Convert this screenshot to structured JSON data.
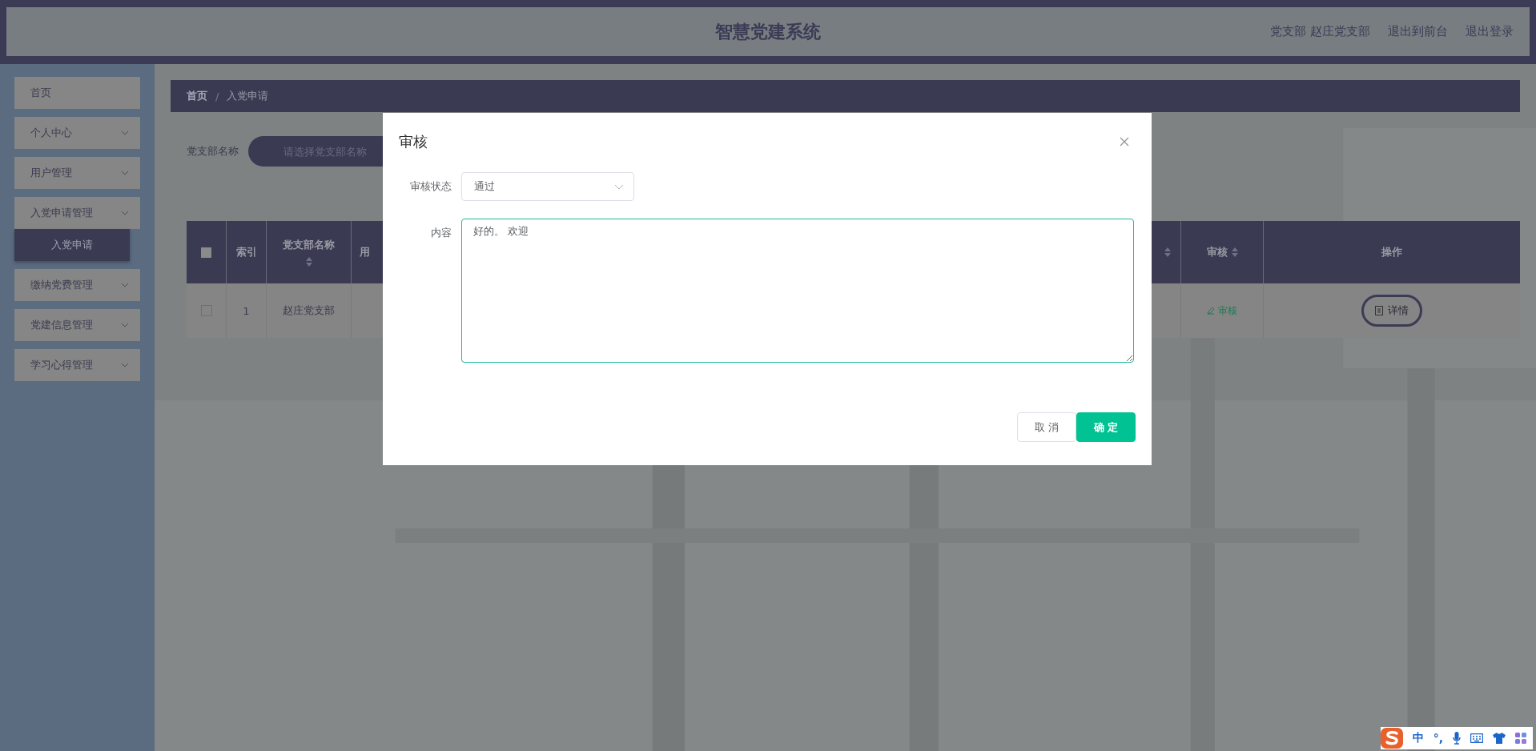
{
  "header": {
    "title": "智慧党建系统",
    "links": [
      "党支部 赵庄党支部",
      "退出到前台",
      "退出登录"
    ]
  },
  "sidebar": {
    "items": [
      {
        "label": "首页",
        "expandable": false
      },
      {
        "label": "个人中心",
        "expandable": true
      },
      {
        "label": "用户管理",
        "expandable": true
      },
      {
        "label": "入党申请管理",
        "expandable": true,
        "children": [
          {
            "label": "入党申请",
            "selected": true
          }
        ]
      },
      {
        "label": "缴纳党费管理",
        "expandable": true
      },
      {
        "label": "党建信息管理",
        "expandable": true
      },
      {
        "label": "学习心得管理",
        "expandable": true
      }
    ]
  },
  "breadcrumb": {
    "separator": "/",
    "items": [
      "首页",
      "入党申请"
    ]
  },
  "filter": {
    "label": "党支部名称",
    "placeholder": "请选择党支部名称"
  },
  "table": {
    "columns": [
      {
        "kind": "checkbox",
        "checked": false
      },
      {
        "kind": "text",
        "label": "索引",
        "sortable": false
      },
      {
        "kind": "text",
        "label": "党支部名称",
        "sortable": true
      },
      {
        "kind": "partial",
        "label": "用"
      },
      {
        "kind": "sortonly",
        "sortable": true
      },
      {
        "kind": "text",
        "label": "审核",
        "sortable": true
      },
      {
        "kind": "text",
        "label": "操作",
        "sortable": false
      }
    ],
    "rows": [
      {
        "checked": false,
        "index": "1",
        "branch": "赵庄党支部",
        "review_link": "审核",
        "detail_button": "详情"
      }
    ]
  },
  "dialog": {
    "title": "审核",
    "status_label": "审核状态",
    "status_value": "通过",
    "content_label": "内容",
    "content_value": "好的。 欢迎",
    "buttons": [
      {
        "label": "取 消",
        "kind": "default"
      },
      {
        "label": "确 定",
        "kind": "primary"
      }
    ]
  },
  "ime_bar": {
    "mode": "中",
    "punct": "°,"
  }
}
